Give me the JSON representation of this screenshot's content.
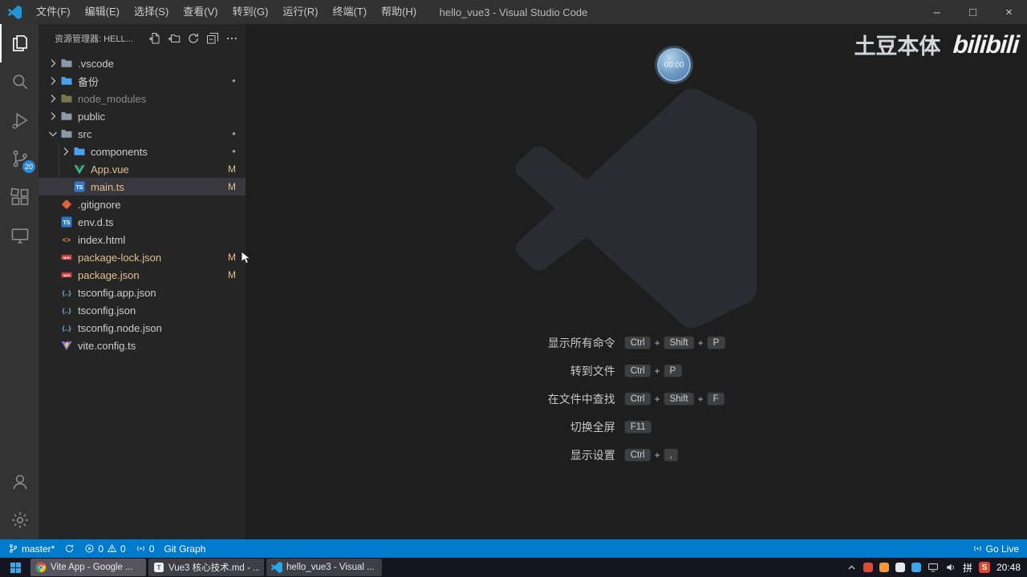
{
  "colors": {
    "accent": "#007acc",
    "modified": "#e2c08d",
    "selection_bg": "#37373d"
  },
  "title_bar": {
    "menus": [
      {
        "name": "file",
        "label": "文件(F)"
      },
      {
        "name": "edit",
        "label": "编辑(E)"
      },
      {
        "name": "selection",
        "label": "选择(S)"
      },
      {
        "name": "view",
        "label": "查看(V)"
      },
      {
        "name": "go",
        "label": "转到(G)"
      },
      {
        "name": "run",
        "label": "运行(R)"
      },
      {
        "name": "terminal",
        "label": "终端(T)"
      },
      {
        "name": "help",
        "label": "帮助(H)"
      }
    ],
    "title": "hello_vue3 - Visual Studio Code",
    "window_controls": {
      "minimize": "–",
      "maximize": "□",
      "close": "×"
    }
  },
  "activity_bar": {
    "top": [
      {
        "name": "explorer",
        "active": true
      },
      {
        "name": "search"
      },
      {
        "name": "run-debug"
      },
      {
        "name": "source-control",
        "badge": "20"
      },
      {
        "name": "extensions"
      },
      {
        "name": "remote-explorer"
      }
    ],
    "bottom": [
      {
        "name": "accounts"
      },
      {
        "name": "settings"
      }
    ]
  },
  "explorer": {
    "header": "资源管理器: HELL...",
    "toolbar": [
      {
        "name": "new-file"
      },
      {
        "name": "new-folder"
      },
      {
        "name": "refresh"
      },
      {
        "name": "collapse-all"
      },
      {
        "name": "more-actions"
      }
    ],
    "tree": [
      {
        "id": "vscode-folder",
        "label": ".vscode",
        "icon": "folder",
        "icon_color": "#8d99a5",
        "level": 0,
        "chevron": "collapsed"
      },
      {
        "id": "backup-folder",
        "label": "备份",
        "icon": "folder",
        "icon_color": "#4ba0e8",
        "level": 0,
        "chevron": "collapsed",
        "dot": true
      },
      {
        "id": "node-modules-folder",
        "label": "node_modules",
        "icon": "folder",
        "icon_color": "#77774d",
        "level": 0,
        "chevron": "collapsed",
        "dim": true
      },
      {
        "id": "public-folder",
        "label": "public",
        "icon": "folder",
        "icon_color": "#8d99a5",
        "level": 0,
        "chevron": "collapsed"
      },
      {
        "id": "src-folder",
        "label": "src",
        "icon": "folder",
        "icon_color": "#8d99a5",
        "level": 0,
        "chevron": "expanded",
        "dot": true
      },
      {
        "id": "components-folder",
        "label": "components",
        "icon": "folder",
        "icon_color": "#4ba0e8",
        "level": 1,
        "chevron": "collapsed",
        "dot": true
      },
      {
        "id": "app-vue-file",
        "label": "App.vue",
        "icon": "vue",
        "level": 1,
        "modified": true,
        "badge": "M"
      },
      {
        "id": "main-ts-file",
        "label": "main.ts",
        "icon": "ts",
        "level": 1,
        "modified": true,
        "badge": "M",
        "selected": true
      },
      {
        "id": "gitignore-file",
        "label": ".gitignore",
        "icon": "git",
        "level": 0
      },
      {
        "id": "env-dts-file",
        "label": "env.d.ts",
        "icon": "ts",
        "level": 0
      },
      {
        "id": "index-html-file",
        "label": "index.html",
        "icon": "html",
        "level": 0
      },
      {
        "id": "package-lock-file",
        "label": "package-lock.json",
        "icon": "npm",
        "level": 0,
        "modified": true,
        "badge": "M"
      },
      {
        "id": "package-json-file",
        "label": "package.json",
        "icon": "npm",
        "level": 0,
        "modified": true,
        "badge": "M"
      },
      {
        "id": "tsconfig-app-file",
        "label": "tsconfig.app.json",
        "icon": "json",
        "level": 0
      },
      {
        "id": "tsconfig-file",
        "label": "tsconfig.json",
        "icon": "json",
        "level": 0
      },
      {
        "id": "tsconfig-node-file",
        "label": "tsconfig.node.json",
        "icon": "json",
        "level": 0
      },
      {
        "id": "vite-config-file",
        "label": "vite.config.ts",
        "icon": "vite",
        "level": 0
      }
    ]
  },
  "editor": {
    "overlay_timer": "00:00",
    "watermark_text": "土豆本体",
    "watermark_logo": "bilibili",
    "shortcuts": [
      {
        "id": "show-all-commands",
        "label": "显示所有命令",
        "keys": [
          "Ctrl",
          "Shift",
          "P"
        ]
      },
      {
        "id": "go-to-file",
        "label": "转到文件",
        "keys": [
          "Ctrl",
          "P"
        ]
      },
      {
        "id": "find-in-files",
        "label": "在文件中查找",
        "keys": [
          "Ctrl",
          "Shift",
          "F"
        ]
      },
      {
        "id": "toggle-fullscreen",
        "label": "切换全屏",
        "keys": [
          "F11"
        ]
      },
      {
        "id": "show-settings",
        "label": "显示设置",
        "keys": [
          "Ctrl",
          ","
        ]
      }
    ]
  },
  "status_bar": {
    "left": [
      {
        "id": "branch",
        "icon": "branch",
        "label": "master*"
      },
      {
        "id": "sync",
        "icon": "sync",
        "label": ""
      },
      {
        "id": "problems",
        "errors": "0",
        "warnings": "0"
      },
      {
        "id": "ports",
        "icon": "broadcast",
        "label": "0"
      },
      {
        "id": "git-graph",
        "label": "Git Graph"
      }
    ],
    "right": [
      {
        "id": "go-live",
        "icon": "broadcast",
        "label": "Go Live"
      }
    ]
  },
  "taskbar": {
    "apps": [
      {
        "id": "chrome-vite-app",
        "icon": "chrome",
        "label": "Vite App - Google ...",
        "active": true
      },
      {
        "id": "typora-vue3-doc",
        "icon": "typora",
        "label": "Vue3 核心技术.md - ..."
      },
      {
        "id": "vscode-hello-vue3",
        "icon": "vscode",
        "label": "hello_vue3 - Visual ..."
      }
    ],
    "tray": {
      "app_icon_colors": [
        "#d84a3a",
        "#ef9b3d",
        "#e8e8e8",
        "#3fa7e5"
      ],
      "ime": "拼",
      "sogou": "S",
      "time": "20:48"
    }
  }
}
